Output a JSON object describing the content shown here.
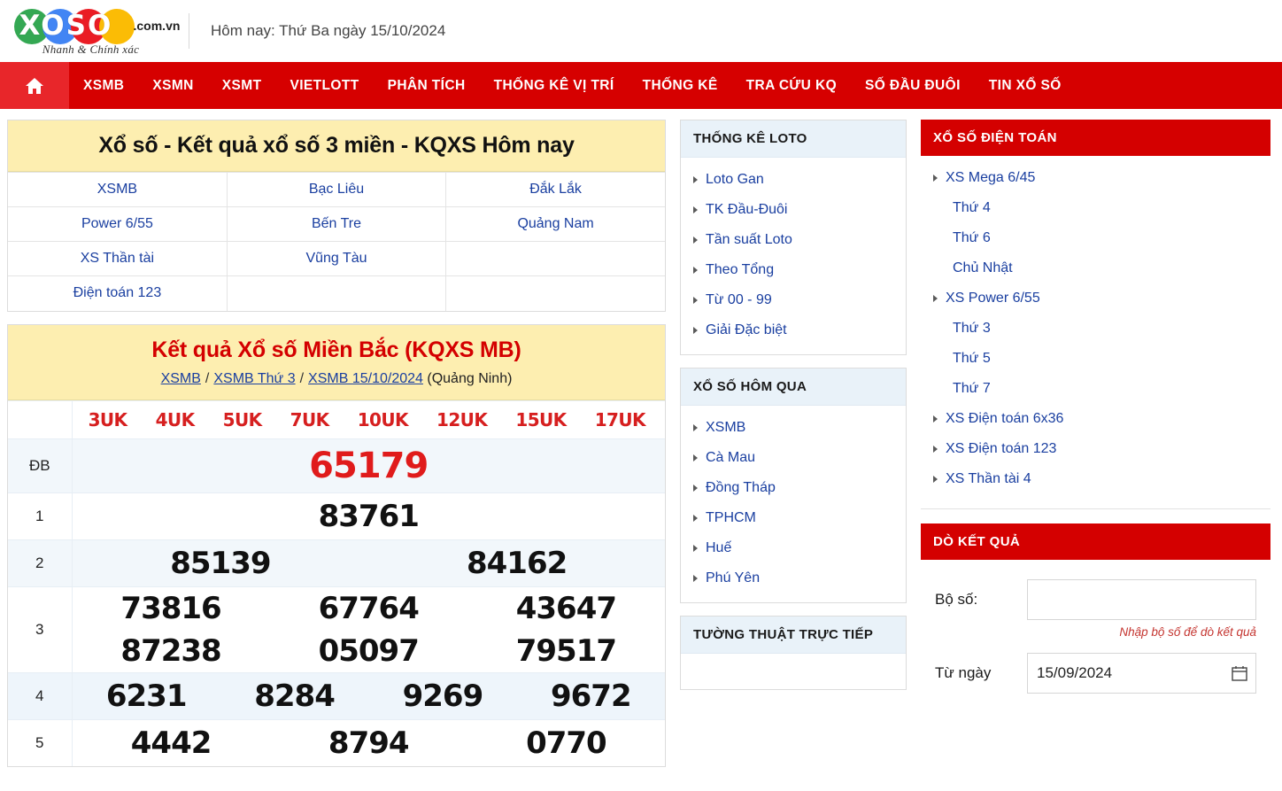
{
  "header": {
    "logo_main": "XOSO",
    "logo_domain": ".com.vn",
    "logo_tagline": "Nhanh & Chính xác",
    "today": "Hôm nay: Thứ Ba ngày 15/10/2024"
  },
  "nav": {
    "home_icon": "home-icon",
    "items": [
      {
        "label": "XSMB"
      },
      {
        "label": "XSMN"
      },
      {
        "label": "XSMT"
      },
      {
        "label": "VIETLOTT"
      },
      {
        "label": "PHÂN TÍCH"
      },
      {
        "label": "THỐNG KÊ VỊ TRÍ"
      },
      {
        "label": "THỐNG KÊ"
      },
      {
        "label": "TRA CỨU KQ"
      },
      {
        "label": "SỐ ĐẦU ĐUÔI"
      },
      {
        "label": "TIN XỔ SỐ"
      }
    ]
  },
  "quick_panel": {
    "title": "Xổ số - Kết quả xổ số 3 miền - KQXS Hôm nay",
    "rows": [
      [
        "XSMB",
        "Bạc Liêu",
        "Đắk Lắk"
      ],
      [
        "Power 6/55",
        "Bến Tre",
        "Quảng Nam"
      ],
      [
        "XS Thần tài",
        "Vũng Tàu",
        ""
      ],
      [
        "Điện toán 123",
        "",
        ""
      ]
    ]
  },
  "results": {
    "title": "Kết quả Xổ số Miền Bắc (KQXS MB)",
    "breadcrumb": {
      "link1": "XSMB",
      "link2": "XSMB Thứ 3",
      "link3": "XSMB 15/10/2024",
      "province": "(Quảng Ninh)",
      "separator": "/"
    },
    "uk_headers": [
      "3UK",
      "4UK",
      "5UK",
      "7UK",
      "10UK",
      "12UK",
      "15UK",
      "17UK"
    ],
    "uk_label": "",
    "rows": [
      {
        "label": "ĐB",
        "numbers": [
          "65179"
        ]
      },
      {
        "label": "1",
        "numbers": [
          "83761"
        ]
      },
      {
        "label": "2",
        "numbers": [
          "85139",
          "84162"
        ]
      },
      {
        "label": "3",
        "numbers": [
          "73816",
          "67764",
          "43647",
          "87238",
          "05097",
          "79517"
        ]
      },
      {
        "label": "4",
        "numbers": [
          "6231",
          "8284",
          "9269",
          "9672"
        ]
      },
      {
        "label": "5",
        "numbers": [
          "4442",
          "8794",
          "0770"
        ]
      }
    ]
  },
  "loto_panel": {
    "title": "THỐNG KÊ LOTO",
    "items": [
      {
        "label": "Loto Gan"
      },
      {
        "label": "TK Đầu-Đuôi"
      },
      {
        "label": "Tần suất Loto"
      },
      {
        "label": "Theo Tổng"
      },
      {
        "label": "Từ 00 - 99"
      },
      {
        "label": "Giải Đặc biệt"
      }
    ]
  },
  "yesterday_panel": {
    "title": "XỔ SỐ HÔM QUA",
    "items": [
      {
        "label": "XSMB"
      },
      {
        "label": "Cà Mau"
      },
      {
        "label": "Đồng Tháp"
      },
      {
        "label": "TPHCM"
      },
      {
        "label": "Huế"
      },
      {
        "label": "Phú Yên"
      }
    ]
  },
  "live_panel": {
    "title": "TƯỜNG THUẬT TRỰC TIẾP"
  },
  "dientoan_panel": {
    "title": "XỔ SỐ ĐIỆN TOÁN",
    "items": [
      {
        "label": "XS Mega 6/45",
        "sub": false
      },
      {
        "label": "Thứ 4",
        "sub": true
      },
      {
        "label": "Thứ 6",
        "sub": true
      },
      {
        "label": "Chủ Nhật",
        "sub": true
      },
      {
        "label": "XS Power 6/55",
        "sub": false
      },
      {
        "label": "Thứ 3",
        "sub": true
      },
      {
        "label": "Thứ 5",
        "sub": true
      },
      {
        "label": "Thứ 7",
        "sub": true
      },
      {
        "label": "XS Điện toán 6x36",
        "sub": false
      },
      {
        "label": "XS Điện toán 123",
        "sub": false
      },
      {
        "label": "XS Thần tài 4",
        "sub": false
      }
    ]
  },
  "check_panel": {
    "title": "DÒ KẾT QUẢ",
    "boso_label": "Bộ số:",
    "boso_value": "",
    "boso_placeholder": "",
    "hint": "Nhập bộ số để dò kết quả",
    "date_label": "Từ ngày",
    "date_value": "15/09/2024",
    "calendar_icon": "calendar-icon"
  },
  "colors": {
    "brand_red": "#d60000",
    "nav_home_red": "#e8262a",
    "panel_yellow": "#fdeeb0",
    "link_blue": "#1a3fa0",
    "prize_red": "#e01b1b"
  }
}
